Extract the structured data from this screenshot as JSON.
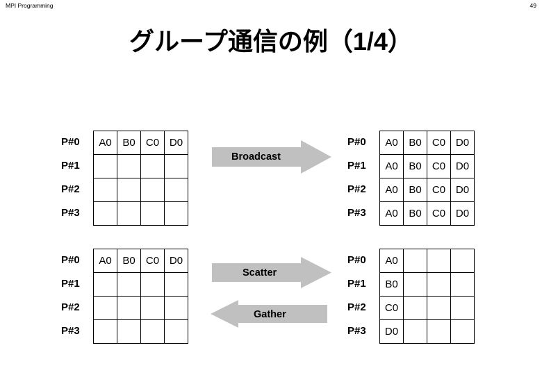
{
  "header": {
    "title": "MPI Programming",
    "page_number": "49"
  },
  "slide": {
    "title": "グループ通信の例（1/4）"
  },
  "colors": {
    "arrow_fill": "#c0c0c0",
    "grid_border": "#000000",
    "text": "#000000",
    "background": "#ffffff"
  },
  "process_labels": [
    "P#0",
    "P#1",
    "P#2",
    "P#3"
  ],
  "diagrams": [
    {
      "id": "broadcast",
      "operation_label": "Broadcast",
      "arrow_direction": "right",
      "source_table": {
        "rows": [
          [
            "A0",
            "B0",
            "C0",
            "D0"
          ],
          [
            "",
            "",
            "",
            ""
          ],
          [
            "",
            "",
            "",
            ""
          ],
          [
            "",
            "",
            "",
            ""
          ]
        ]
      },
      "result_table": {
        "rows": [
          [
            "A0",
            "B0",
            "C0",
            "D0"
          ],
          [
            "A0",
            "B0",
            "C0",
            "D0"
          ],
          [
            "A0",
            "B0",
            "C0",
            "D0"
          ],
          [
            "A0",
            "B0",
            "C0",
            "D0"
          ]
        ]
      }
    },
    {
      "id": "scatter-gather",
      "operation_label": "Scatter",
      "operation_label_2": "Gather",
      "arrow_direction": "right",
      "arrow_direction_2": "left",
      "source_table": {
        "rows": [
          [
            "A0",
            "B0",
            "C0",
            "D0"
          ],
          [
            "",
            "",
            "",
            ""
          ],
          [
            "",
            "",
            "",
            ""
          ],
          [
            "",
            "",
            "",
            ""
          ]
        ]
      },
      "result_table": {
        "rows": [
          [
            "A0",
            "",
            "",
            ""
          ],
          [
            "B0",
            "",
            "",
            ""
          ],
          [
            "C0",
            "",
            "",
            ""
          ],
          [
            "D0",
            "",
            "",
            ""
          ]
        ]
      }
    }
  ]
}
